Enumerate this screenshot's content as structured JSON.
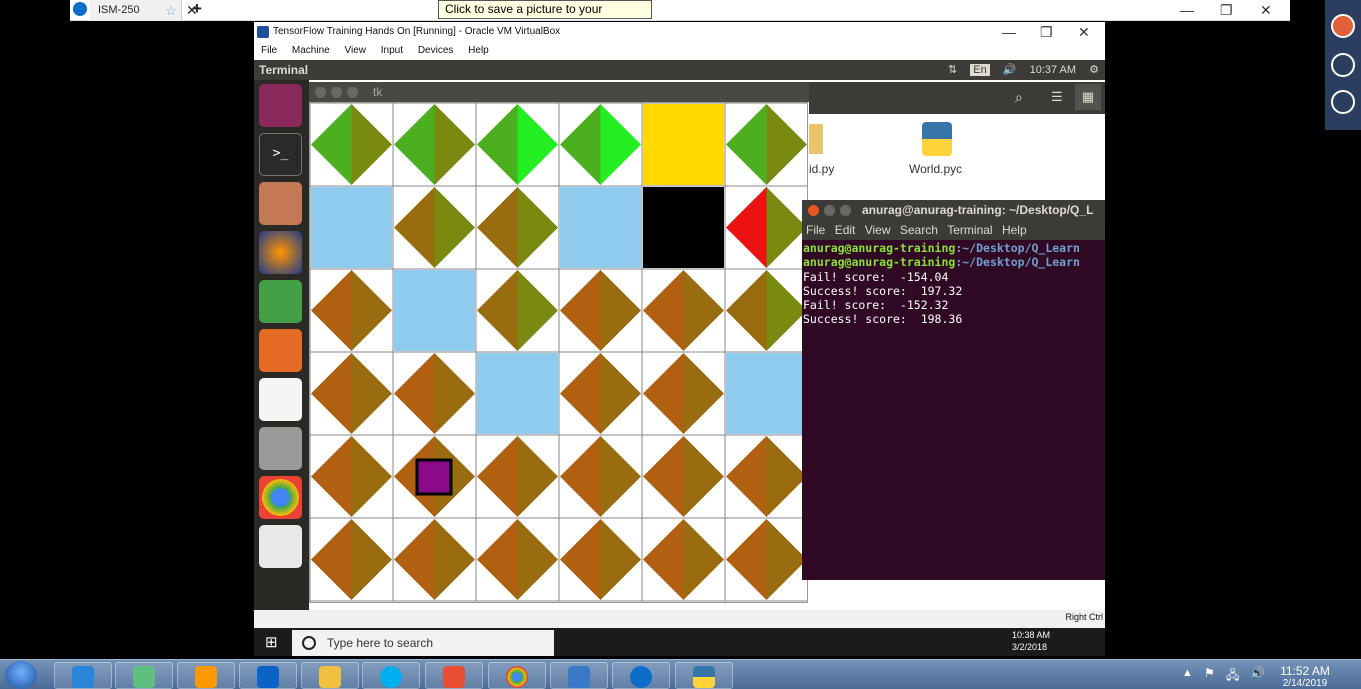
{
  "tooltip": "Click to save a picture to your desktop.",
  "teamviewer": {
    "tab_label": "ISM-250",
    "star_icon": "star-icon",
    "close_icon": "close-icon",
    "add_icon": "plus-icon"
  },
  "vbox": {
    "title": "TensorFlow Training Hands On [Running] - Oracle VM VirtualBox",
    "menu": [
      "File",
      "Machine",
      "View",
      "Input",
      "Devices",
      "Help"
    ],
    "host_key": "Right Ctrl"
  },
  "ubuntu_panel": {
    "title": "Terminal",
    "keyboard": "En",
    "time": "10:37 AM"
  },
  "tk_window": {
    "title": "tk"
  },
  "files": [
    {
      "name": "id.py"
    },
    {
      "name": "World.pyc"
    }
  ],
  "terminal": {
    "title": "anurag@anurag-training: ~/Desktop/Q_L",
    "menu": [
      "File",
      "Edit",
      "View",
      "Search",
      "Terminal",
      "Help"
    ],
    "prompt_user": "anurag@anurag-training",
    "prompt_path": ":~/Desktop/Q_Learn",
    "lines": [
      "Fail! score:  -154.04",
      "Success! score:  197.32",
      "Fail! score:  -152.32",
      "Success! score:  198.36"
    ]
  },
  "win10": {
    "search_placeholder": "Type here to search",
    "time": "10:38 AM",
    "date": "3/2/2018"
  },
  "win7": {
    "time": "11:52 AM",
    "date": "2/14/2019"
  },
  "grid": {
    "rows": [
      [
        "diamond-green",
        "diamond-green",
        "diamond-brightgreen",
        "diamond-brightgreen",
        "goal-yellow",
        "diamond-green"
      ],
      [
        "wall-blue",
        "diamond-olive",
        "diamond-olive",
        "wall-blue",
        "pit-black",
        "diamond-red"
      ],
      [
        "diamond-brown",
        "wall-blue",
        "diamond-olive",
        "diamond-brown",
        "diamond-brown",
        "diamond-olive"
      ],
      [
        "diamond-brown",
        "diamond-brown",
        "wall-blue",
        "diamond-brown",
        "diamond-brown",
        "wall-blue"
      ],
      [
        "diamond-brown",
        "agent-purple",
        "diamond-brown",
        "diamond-brown",
        "diamond-brown",
        "diamond-brown"
      ],
      [
        "diamond-brown",
        "diamond-brown",
        "diamond-brown",
        "diamond-brown",
        "diamond-brown",
        "diamond-brown"
      ]
    ],
    "colors": {
      "green": "#4caf20",
      "olive": "#7a8a10",
      "bright_green": "#22ee22",
      "yellow": "#ffd800",
      "blue": "#8ecbee",
      "black": "#000000",
      "red": "#ee1111",
      "brown": "#b06010",
      "dark_brown": "#9a6c10",
      "purple": "#8a0a8a"
    }
  }
}
